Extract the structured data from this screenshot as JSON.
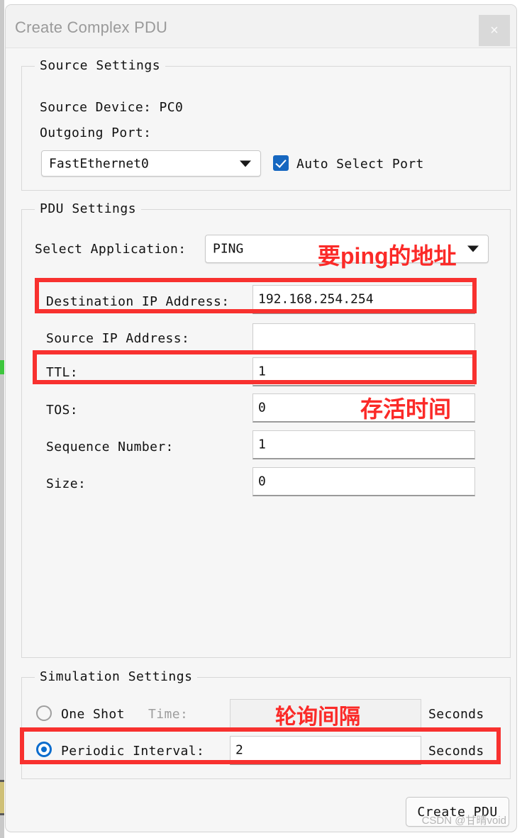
{
  "window": {
    "title": "Create Complex PDU",
    "close_label": "×"
  },
  "source_settings": {
    "group_title": "Source Settings",
    "device_label": "Source Device: PC0",
    "outgoing_port_label": "Outgoing Port:",
    "port_value": "FastEthernet0",
    "auto_select_label": "Auto Select Port",
    "auto_select_checked": true
  },
  "pdu_settings": {
    "group_title": "PDU Settings",
    "select_application_label": "Select Application:",
    "select_application_value": "PING",
    "fields": [
      {
        "label": "Destination IP Address:",
        "value": "192.168.254.254"
      },
      {
        "label": "Source IP Address:",
        "value": ""
      },
      {
        "label": "TTL:",
        "value": "1"
      },
      {
        "label": "TOS:",
        "value": "0"
      },
      {
        "label": "Sequence Number:",
        "value": "1"
      },
      {
        "label": "Size:",
        "value": "0"
      }
    ]
  },
  "simulation_settings": {
    "group_title": "Simulation Settings",
    "one_shot_label": "One Shot",
    "one_shot_selected": false,
    "time_label": "Time:",
    "time_value": "",
    "time_seconds_label": "Seconds",
    "periodic_label": "Periodic  Interval:",
    "periodic_selected": true,
    "periodic_value": "2",
    "periodic_seconds_label": "Seconds"
  },
  "actions": {
    "create_pdu_label": "Create PDU"
  },
  "annotations": {
    "ping_address": "要ping的地址",
    "ttl_meaning": "存活时间",
    "poll_interval": "轮询间隔",
    "color": "#fb2a28"
  },
  "watermark": {
    "text": "CSDN @甘晴void"
  }
}
